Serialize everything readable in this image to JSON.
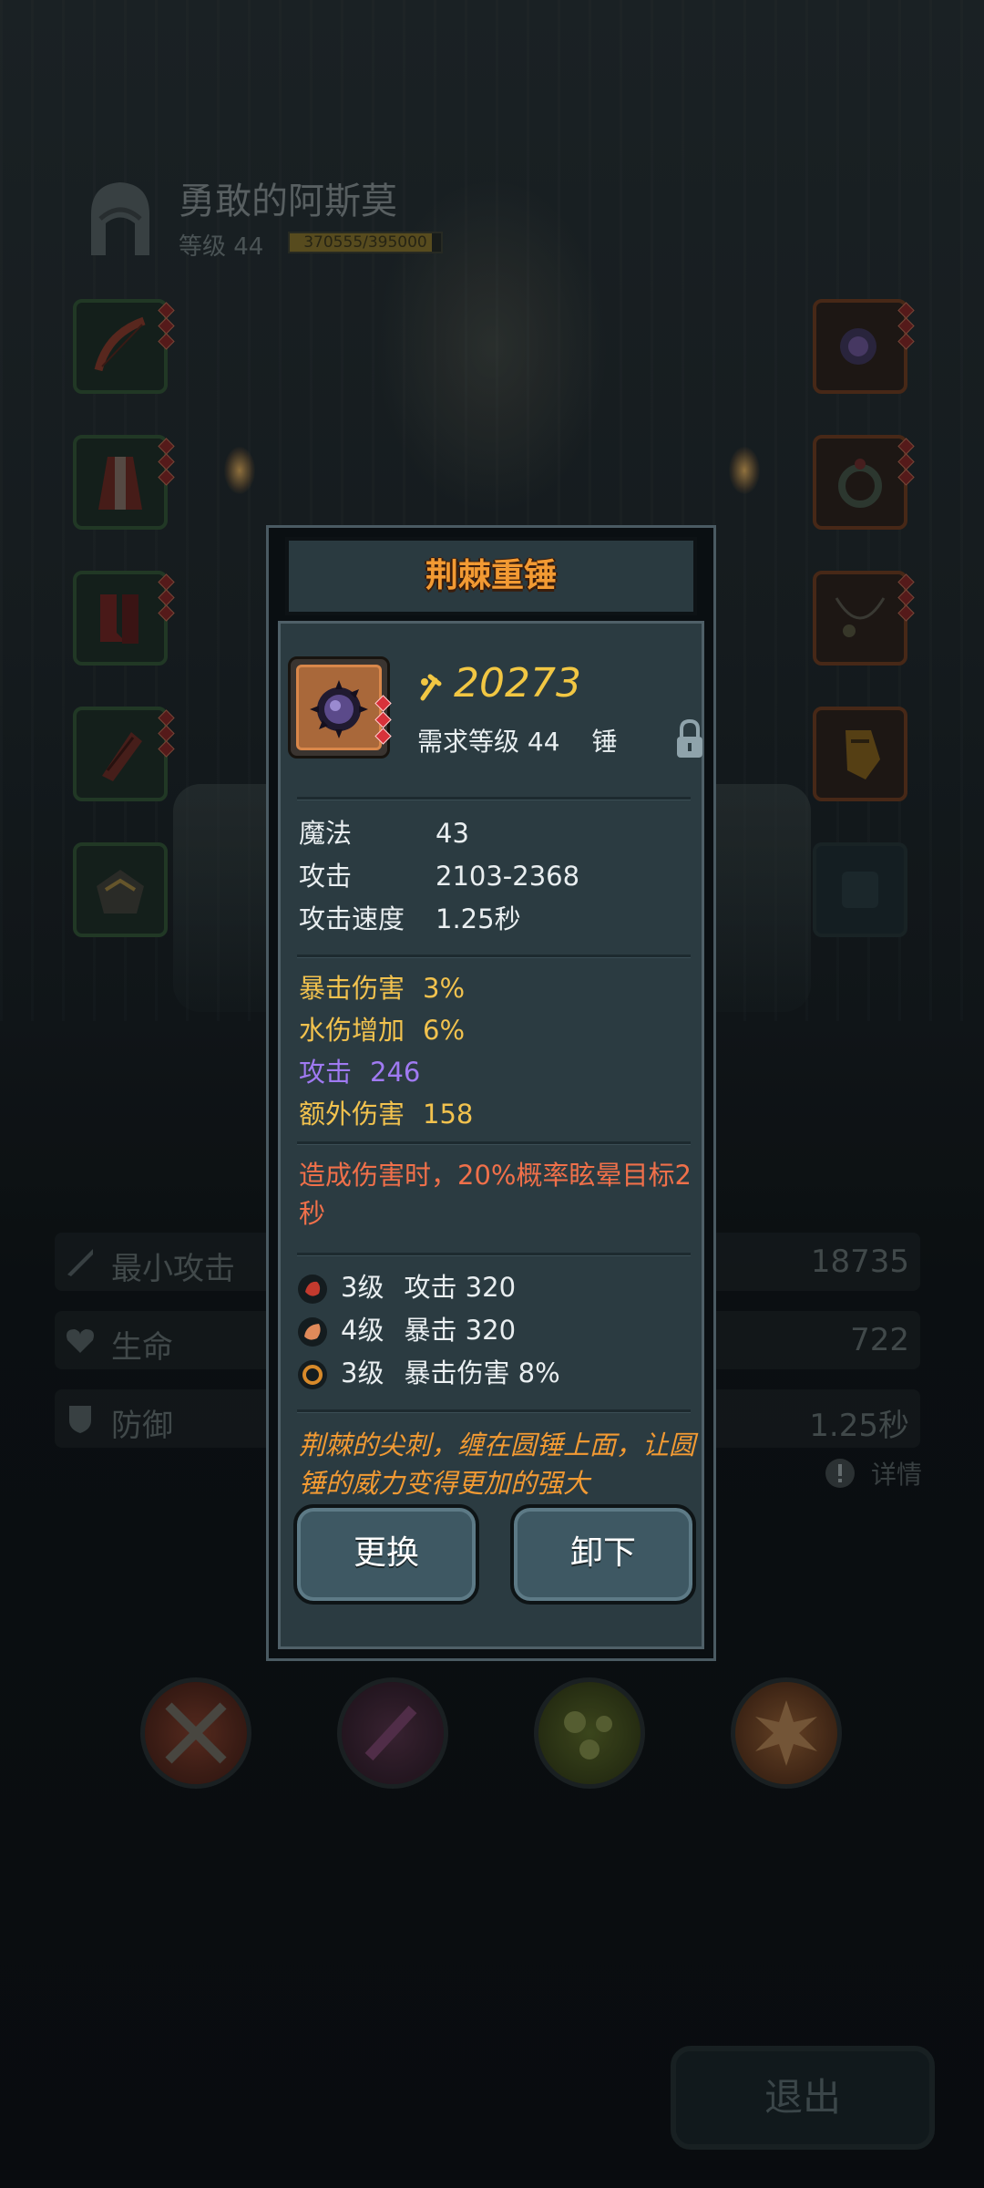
{
  "hero": {
    "name": "勇敢的阿斯莫",
    "level_label": "等级 44",
    "xp_text": "370555/395000",
    "xp_fraction": 0.938
  },
  "equipment": {
    "left": [
      "bow-icon",
      "robe-icon",
      "boots-icon",
      "gloves-icon",
      "helmet-icon"
    ],
    "right": [
      "mace-icon",
      "ring-icon",
      "necklace-icon",
      "gauntlet-icon",
      "empty-slot"
    ]
  },
  "stats": [
    {
      "label": "最小攻击",
      "value": "18735",
      "icon": "sword-icon"
    },
    {
      "label": "生命",
      "value": "722",
      "icon": "heart-icon"
    },
    {
      "label": "防御",
      "value": "1.25秒",
      "icon": "shield-icon"
    }
  ],
  "detail_label": "详情",
  "skills": [
    "crossed-axes-icon",
    "purple-sword-icon",
    "green-orb-icon",
    "explosion-icon"
  ],
  "exit_label": "退出",
  "item": {
    "name": "荆棘重锤",
    "power": "20273",
    "req_level": "需求等级 44",
    "type": "锤",
    "base_stats": [
      {
        "label": "魔法",
        "value": "43"
      },
      {
        "label": "攻击",
        "value": "2103-2368"
      },
      {
        "label": "攻击速度",
        "value": "1.25秒"
      }
    ],
    "bonus_stats": [
      {
        "label": "暴击伤害",
        "value": "3%",
        "color": "#f2c24e"
      },
      {
        "label": "水伤增加",
        "value": "6%",
        "color": "#f2c24e"
      },
      {
        "label": "攻击",
        "value": "246",
        "color": "#a07af2"
      },
      {
        "label": "额外伤害",
        "value": "158",
        "color": "#f2c24e"
      }
    ],
    "effect": "造成伤害时，20%概率眩晕目标2秒",
    "gems": [
      {
        "level": "3级",
        "stat": "攻击 320",
        "icon": "red-gem-icon"
      },
      {
        "level": "4级",
        "stat": "暴击 320",
        "icon": "orange-gem-icon"
      },
      {
        "level": "3级",
        "stat": "暴击伤害 8%",
        "icon": "amber-gem-icon"
      }
    ],
    "flavor": "荆棘的尖刺，缠在圆锤上面，让圆锤的威力变得更加的强大",
    "replace_label": "更换",
    "unequip_label": "卸下"
  }
}
